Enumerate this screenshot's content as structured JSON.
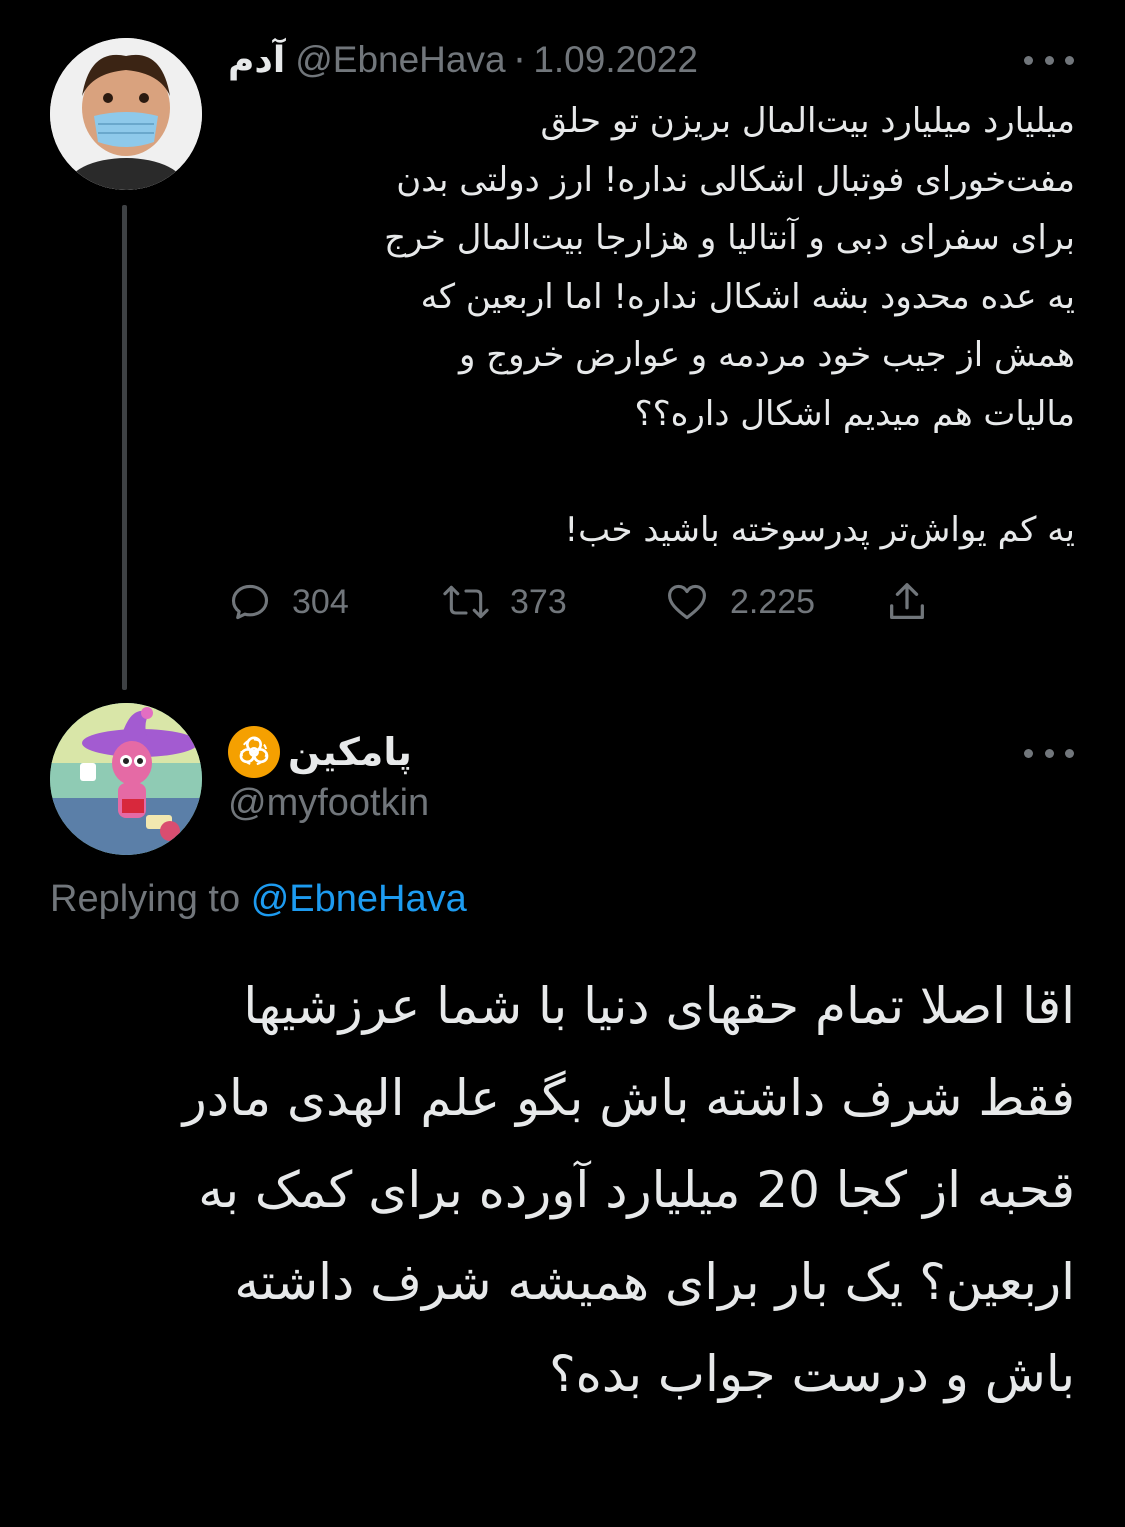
{
  "original_tweet": {
    "author_name": "آدم",
    "handle": "@EbneHava",
    "separator": "·",
    "date": "1.09.2022",
    "avatar_icon": "avatar-child-with-mask",
    "lines": [
      "میلیارد میلیارد بیت‌المال بریزن تو حلق",
      "مفت‌خورای فوتبال اشکالی نداره! ارز دولتی بدن",
      "برای سفرای دبی و آنتالیا و هزارجا بیت‌المال خرج",
      "یه عده محدود بشه اشکال نداره! اما اربعین که",
      "همش از جیب خود مردمه و عوارض خروج و",
      "مالیات هم میدیم اشکال داره؟؟"
    ],
    "closing_line": "یه کم یواش‌تر پدرسوخته باشید خب!",
    "stats": {
      "replies": "304",
      "retweets": "373",
      "likes": "2.225"
    }
  },
  "reply_tweet": {
    "author_name": "پامکین",
    "name_badge_icon": "biohazard-icon",
    "handle": "@myfootkin",
    "avatar_icon": "avatar-cartoon-witch-hat",
    "replying_prefix": "Replying to",
    "replying_to": "@EbneHava",
    "lines": [
      "اقا اصلا تمام حقهای دنیا با شما عرزشیها",
      "فقط شرف داشته باش بگو علم الهدی مادر",
      "قحبه از کجا 20 میلیارد آورده برای کمک به",
      "اربعین؟ یک بار برای همیشه شرف داشته",
      "باش و درست جواب بده؟"
    ]
  },
  "colors": {
    "background": "#000000",
    "text": "#e7e9ea",
    "secondary": "#71767b",
    "link": "#1d9bf0",
    "badge": "#f5a000"
  }
}
